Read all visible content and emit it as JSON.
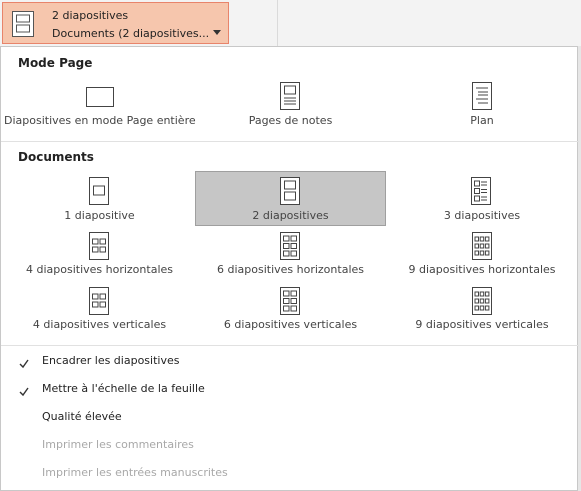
{
  "dropdown": {
    "line1": "2 diapositives",
    "line2": "Documents (2 diapositives..."
  },
  "mode_page": {
    "title": "Mode Page",
    "items": [
      {
        "label": "Diapositives en mode Page entière",
        "icon": "full-page-slide-icon"
      },
      {
        "label": "Pages de notes",
        "icon": "notes-pages-icon"
      },
      {
        "label": "Plan",
        "icon": "outline-icon"
      }
    ]
  },
  "documents": {
    "title": "Documents",
    "items": [
      {
        "label": "1 diapositive",
        "icon": "one-slide-icon"
      },
      {
        "label": "2 diapositives",
        "icon": "two-slides-icon",
        "selected": true
      },
      {
        "label": "3 diapositives",
        "icon": "three-slides-icon"
      },
      {
        "label": "4 diapositives horizontales",
        "icon": "four-slides-horizontal-icon"
      },
      {
        "label": "6 diapositives horizontales",
        "icon": "six-slides-horizontal-icon"
      },
      {
        "label": "9 diapositives horizontales",
        "icon": "nine-slides-horizontal-icon"
      },
      {
        "label": "4 diapositives verticales",
        "icon": "four-slides-vertical-icon"
      },
      {
        "label": "6 diapositives verticales",
        "icon": "six-slides-vertical-icon"
      },
      {
        "label": "9 diapositives verticales",
        "icon": "nine-slides-vertical-icon"
      }
    ]
  },
  "options": [
    {
      "label": "Encadrer les diapositives",
      "checked": true,
      "enabled": true
    },
    {
      "label": "Mettre à l'échelle de la feuille",
      "checked": true,
      "enabled": true
    },
    {
      "label": "Qualité élevée",
      "checked": false,
      "enabled": true
    },
    {
      "label": "Imprimer les commentaires",
      "checked": false,
      "enabled": false
    },
    {
      "label": "Imprimer les entrées manuscrites",
      "checked": false,
      "enabled": false
    }
  ],
  "colors": {
    "accent_bg": "#f6c6ad",
    "accent_border": "#e8846b",
    "selected_bg": "#c6c6c6",
    "disabled_text": "#a8a8a8"
  }
}
